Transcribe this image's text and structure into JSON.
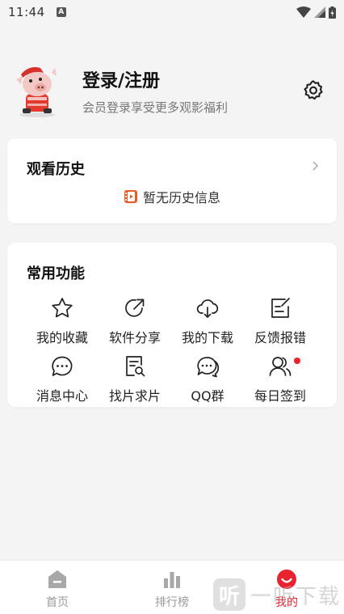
{
  "status_bar": {
    "time": "11:44",
    "notification_letter": "A"
  },
  "profile": {
    "title": "登录/注册",
    "subtitle": "会员登录享受更多观影福利",
    "avatar_icon": "pig-cartoon-avatar",
    "settings_icon": "gear-icon"
  },
  "history": {
    "title": "观看历史",
    "empty_text": "暂无历史信息",
    "chevron_icon": "chevron-right-icon",
    "empty_icon": "film-icon"
  },
  "functions": {
    "title": "常用功能",
    "items": [
      {
        "label": "我的收藏",
        "icon": "star-icon"
      },
      {
        "label": "软件分享",
        "icon": "share-icon"
      },
      {
        "label": "我的下载",
        "icon": "cloud-download-icon"
      },
      {
        "label": "反馈报错",
        "icon": "edit-icon"
      },
      {
        "label": "消息中心",
        "icon": "message-icon"
      },
      {
        "label": "找片求片",
        "icon": "document-search-icon"
      },
      {
        "label": "QQ群",
        "icon": "chat-bubbles-icon"
      },
      {
        "label": "每日签到",
        "icon": "users-icon",
        "badge": true
      }
    ]
  },
  "bottom_nav": {
    "items": [
      {
        "label": "首页",
        "icon": "home-icon",
        "active": false
      },
      {
        "label": "排行榜",
        "icon": "bar-chart-icon",
        "active": false
      },
      {
        "label": "我的",
        "icon": "smile-icon",
        "active": true
      }
    ]
  },
  "watermark": {
    "box_char": "听",
    "text": "一听下载"
  },
  "colors": {
    "accent": "#e8232f",
    "background": "#f4f4f4",
    "card": "#ffffff"
  }
}
